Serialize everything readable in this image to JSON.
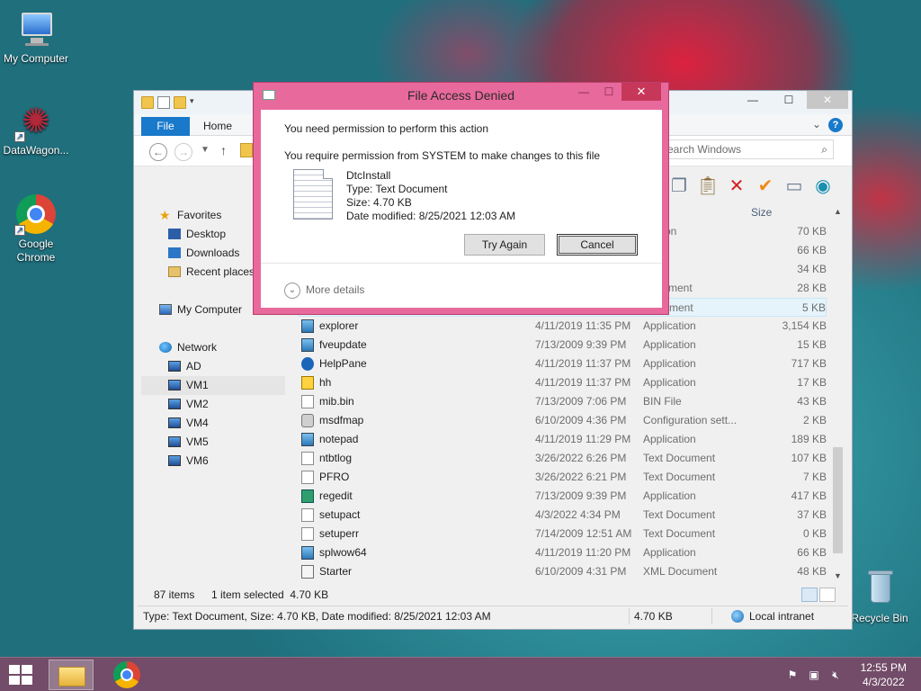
{
  "desktop": {
    "icons": [
      {
        "label": "My Computer"
      },
      {
        "label": "DataWagon..."
      },
      {
        "label": "Google\nChrome"
      },
      {
        "label": "Recycle Bin"
      }
    ]
  },
  "explorer": {
    "ribbon": {
      "file_tab": "File",
      "home_tab": "Home",
      "help": "?"
    },
    "search": {
      "placeholder": "earch Windows"
    },
    "nav": {
      "favorites": "Favorites",
      "desktop": "Desktop",
      "downloads": "Downloads",
      "recent": "Recent places",
      "my_computer": "My Computer",
      "network": "Network",
      "machines": [
        "AD",
        "VM1",
        "VM2",
        "VM4",
        "VM5",
        "VM6"
      ]
    },
    "columns": {
      "size": "Size"
    },
    "files": [
      {
        "name": "",
        "date": "",
        "type": "lication",
        "size": "70 KB",
        "icon": "app"
      },
      {
        "name": "",
        "date": "",
        "type": "File",
        "size": "66 KB",
        "icon": "app"
      },
      {
        "name": "",
        "date": "",
        "type": "",
        "size": "34 KB",
        "icon": "app"
      },
      {
        "name": "",
        "date": "",
        "type": "Document",
        "size": "28 KB",
        "icon": "txt"
      },
      {
        "name": "",
        "date": "",
        "type": "Document",
        "size": "5 KB",
        "icon": "txt",
        "selected": true
      },
      {
        "name": "explorer",
        "date": "4/11/2019 11:35 PM",
        "type": "Application",
        "size": "3,154 KB",
        "icon": "folder"
      },
      {
        "name": "fveupdate",
        "date": "7/13/2009 9:39 PM",
        "type": "Application",
        "size": "15 KB",
        "icon": "app"
      },
      {
        "name": "HelpPane",
        "date": "4/11/2019 11:37 PM",
        "type": "Application",
        "size": "717 KB",
        "icon": "help"
      },
      {
        "name": "hh",
        "date": "4/11/2019 11:37 PM",
        "type": "Application",
        "size": "17 KB",
        "icon": "hh"
      },
      {
        "name": "mib.bin",
        "date": "7/13/2009 7:06 PM",
        "type": "BIN File",
        "size": "43 KB",
        "icon": "txt"
      },
      {
        "name": "msdfmap",
        "date": "6/10/2009 4:36 PM",
        "type": "Configuration sett...",
        "size": "2 KB",
        "icon": "cfg"
      },
      {
        "name": "notepad",
        "date": "4/11/2019 11:29 PM",
        "type": "Application",
        "size": "189 KB",
        "icon": "app"
      },
      {
        "name": "ntbtlog",
        "date": "3/26/2022 6:26 PM",
        "type": "Text Document",
        "size": "107 KB",
        "icon": "txt"
      },
      {
        "name": "PFRO",
        "date": "3/26/2022 6:21 PM",
        "type": "Text Document",
        "size": "7 KB",
        "icon": "txt"
      },
      {
        "name": "regedit",
        "date": "7/13/2009 9:39 PM",
        "type": "Application",
        "size": "417 KB",
        "icon": "reg"
      },
      {
        "name": "setupact",
        "date": "4/3/2022 4:34 PM",
        "type": "Text Document",
        "size": "37 KB",
        "icon": "txt"
      },
      {
        "name": "setuperr",
        "date": "7/14/2009 12:51 AM",
        "type": "Text Document",
        "size": "0 KB",
        "icon": "txt"
      },
      {
        "name": "splwow64",
        "date": "4/11/2019 11:20 PM",
        "type": "Application",
        "size": "66 KB",
        "icon": "app"
      },
      {
        "name": "Starter",
        "date": "6/10/2009 4:31 PM",
        "type": "XML Document",
        "size": "48 KB",
        "icon": "xml"
      }
    ],
    "status": {
      "item_count": "87 items",
      "selected": "1 item selected  4.70 KB",
      "details": "Type: Text Document, Size: 4.70 KB, Date modified: 8/25/2021 12:03 AM",
      "size": "4.70 KB",
      "zone": "Local intranet"
    }
  },
  "dialog": {
    "title": "File Access Denied",
    "line1": "You need permission to perform this action",
    "line2": "You require permission from SYSTEM to make changes to this file",
    "file": {
      "name": "DtcInstall",
      "type": "Type: Text Document",
      "size": "Size: 4.70 KB",
      "modified": "Date modified: 8/25/2021 12:03 AM"
    },
    "try_again": "Try Again",
    "cancel": "Cancel",
    "more_details": "More details"
  },
  "taskbar": {
    "time": "12:55 PM",
    "date": "4/3/2022"
  }
}
